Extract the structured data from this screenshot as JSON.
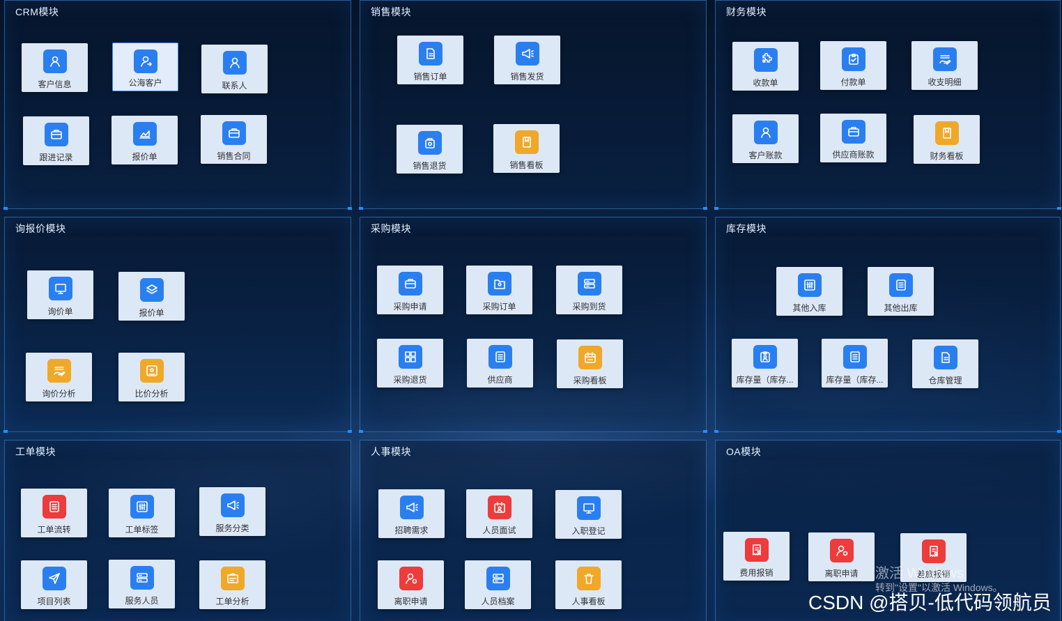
{
  "panels": [
    {
      "title": "CRM模块",
      "tiles": [
        {
          "label": "客户信息",
          "icon": "user-icon",
          "color": "blue"
        },
        {
          "label": "公海客户",
          "icon": "user-share-icon",
          "color": "blue",
          "selected": true
        },
        {
          "label": "联系人",
          "icon": "user-icon",
          "color": "blue"
        },
        {
          "label": "跟进记录",
          "icon": "briefcase-icon",
          "color": "blue"
        },
        {
          "label": "报价单",
          "icon": "chart-icon",
          "color": "blue"
        },
        {
          "label": "销售合同",
          "icon": "briefcase-icon",
          "color": "blue"
        }
      ]
    },
    {
      "title": "销售模块",
      "tiles": [
        {
          "label": "销售订单",
          "icon": "document-icon",
          "color": "blue"
        },
        {
          "label": "销售发货",
          "icon": "megaphone-icon",
          "color": "blue"
        },
        {
          "label": "销售退货",
          "icon": "bag-icon",
          "color": "blue"
        },
        {
          "label": "销售看板",
          "icon": "board-icon",
          "color": "yellow"
        }
      ]
    },
    {
      "title": "财务模块",
      "tiles": [
        {
          "label": "收款单",
          "icon": "puzzle-icon",
          "color": "blue"
        },
        {
          "label": "付款单",
          "icon": "clipboard-check-icon",
          "color": "blue"
        },
        {
          "label": "收支明细",
          "icon": "hand-money-icon",
          "color": "blue"
        },
        {
          "label": "客户账款",
          "icon": "user-icon",
          "color": "blue"
        },
        {
          "label": "供应商账款",
          "icon": "briefcase-icon",
          "color": "blue"
        },
        {
          "label": "财务看板",
          "icon": "board-icon",
          "color": "yellow"
        }
      ]
    },
    {
      "title": "询报价模块",
      "tiles": [
        {
          "label": "询价单",
          "icon": "monitor-icon",
          "color": "blue"
        },
        {
          "label": "报价单",
          "icon": "layers-icon",
          "color": "blue"
        },
        {
          "label": "询价分析",
          "icon": "hand-money-icon",
          "color": "yellow"
        },
        {
          "label": "比价分析",
          "icon": "target-icon",
          "color": "yellow"
        }
      ]
    },
    {
      "title": "采购模块",
      "tiles": [
        {
          "label": "采购申请",
          "icon": "briefcase-icon",
          "color": "blue"
        },
        {
          "label": "采购订单",
          "icon": "folder-icon",
          "color": "blue"
        },
        {
          "label": "采购到货",
          "icon": "server-icon",
          "color": "blue"
        },
        {
          "label": "采购退货",
          "icon": "grid-icon",
          "color": "blue"
        },
        {
          "label": "供应商",
          "icon": "list-icon",
          "color": "blue"
        },
        {
          "label": "采购看板",
          "icon": "calendar-icon",
          "color": "yellow"
        }
      ]
    },
    {
      "title": "库存模块",
      "tiles": [
        {
          "label": "其他入库",
          "icon": "sliders-icon",
          "color": "blue"
        },
        {
          "label": "其他出库",
          "icon": "list-icon",
          "color": "blue"
        },
        {
          "label": "库存量（库存...",
          "icon": "clipboard-user-icon",
          "color": "blue"
        },
        {
          "label": "库存量（库存...",
          "icon": "list-icon",
          "color": "blue"
        },
        {
          "label": "仓库管理",
          "icon": "document-icon",
          "color": "blue"
        }
      ]
    },
    {
      "title": "工单模块",
      "tiles": [
        {
          "label": "工单流转",
          "icon": "list-icon",
          "color": "red"
        },
        {
          "label": "工单标签",
          "icon": "sliders-icon",
          "color": "blue"
        },
        {
          "label": "服务分类",
          "icon": "megaphone-icon",
          "color": "blue"
        },
        {
          "label": "项目列表",
          "icon": "send-icon",
          "color": "blue"
        },
        {
          "label": "服务人员",
          "icon": "server-icon",
          "color": "blue"
        },
        {
          "label": "工单分析",
          "icon": "news-icon",
          "color": "yellow"
        }
      ]
    },
    {
      "title": "人事模块",
      "tiles": [
        {
          "label": "招聘需求",
          "icon": "megaphone-icon",
          "color": "blue"
        },
        {
          "label": "人员面试",
          "icon": "calendar-user-icon",
          "color": "red"
        },
        {
          "label": "入职登记",
          "icon": "monitor-icon",
          "color": "blue"
        },
        {
          "label": "离职申请",
          "icon": "user-gear-icon",
          "color": "red"
        },
        {
          "label": "人员档案",
          "icon": "server-icon",
          "color": "blue"
        },
        {
          "label": "人事看板",
          "icon": "trash-icon",
          "color": "yellow"
        }
      ]
    },
    {
      "title": "OA模块",
      "tiles": [
        {
          "label": "费用报销",
          "icon": "receipt-icon",
          "color": "red"
        },
        {
          "label": "离职申请",
          "icon": "user-gear-icon",
          "color": "red"
        },
        {
          "label": "差旅报销",
          "icon": "receipt-icon",
          "color": "red"
        }
      ]
    }
  ],
  "watermark": {
    "line1": "激活 Windows",
    "line2": "转到\"设置\"以激活 Windows。",
    "csdn": "CSDN @搭贝-低代码领航员"
  }
}
